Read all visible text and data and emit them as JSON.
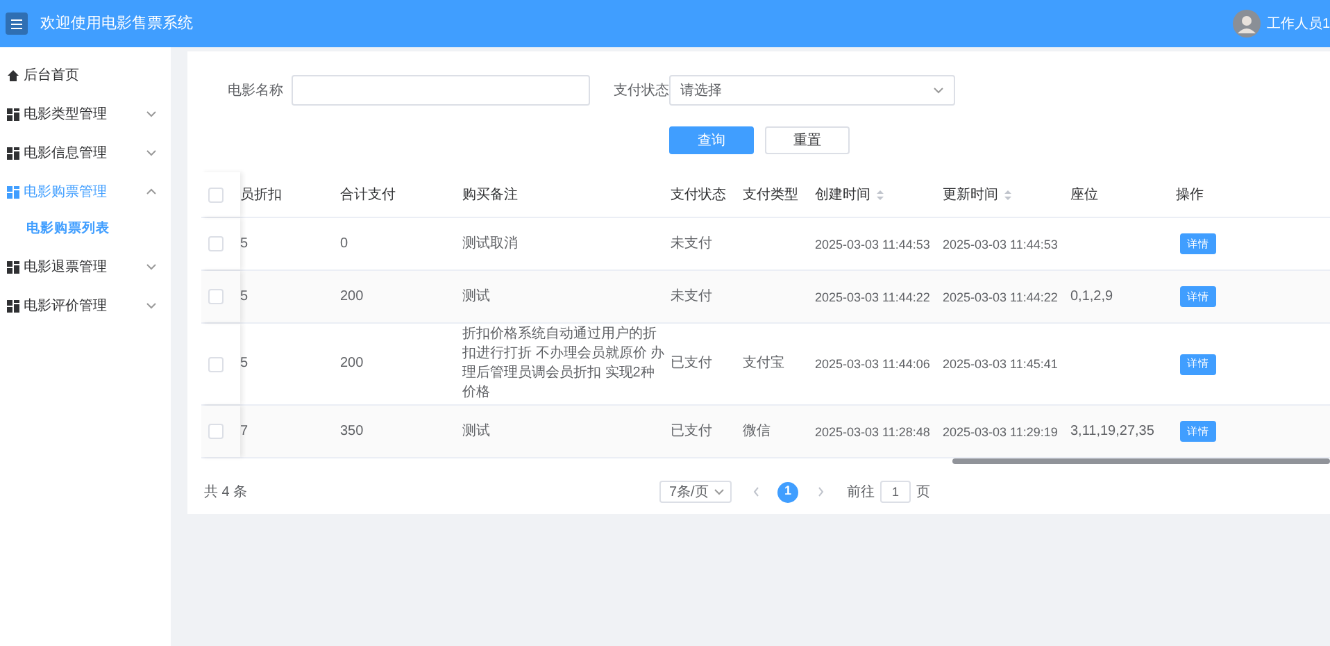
{
  "header": {
    "title": "欢迎使用电影售票系统",
    "user": "工作人员1"
  },
  "sidebar": {
    "items": [
      {
        "label": "后台首页",
        "kind": "home",
        "selected": false
      },
      {
        "label": "电影类型管理",
        "kind": "group",
        "expanded": false,
        "selected": false
      },
      {
        "label": "电影信息管理",
        "kind": "group",
        "expanded": false,
        "selected": false
      },
      {
        "label": "电影购票管理",
        "kind": "group",
        "expanded": true,
        "selected": true,
        "children": [
          {
            "label": "电影购票列表",
            "selected": true
          }
        ]
      },
      {
        "label": "电影退票管理",
        "kind": "group",
        "expanded": false,
        "selected": false
      },
      {
        "label": "电影评价管理",
        "kind": "group",
        "expanded": false,
        "selected": false
      }
    ]
  },
  "filters": {
    "movie_name": {
      "label": "电影名称"
    },
    "pay_status": {
      "label": "支付状态",
      "placeholder": "请选择"
    }
  },
  "buttons": {
    "search": "查询",
    "reset": "重置"
  },
  "table": {
    "all_checked": false,
    "columns": [
      {
        "label": "员折扣",
        "sortable": false
      },
      {
        "label": "合计支付",
        "sortable": false
      },
      {
        "label": "购买备注",
        "sortable": false
      },
      {
        "label": "支付状态",
        "sortable": false
      },
      {
        "label": "支付类型",
        "sortable": false
      },
      {
        "label": "创建时间",
        "sortable": true
      },
      {
        "label": "更新时间",
        "sortable": true
      },
      {
        "label": "座位",
        "sortable": false
      },
      {
        "label": "操作",
        "sortable": false
      }
    ],
    "rows": [
      {
        "checked": false,
        "cells": [
          "5",
          "0",
          "测试取消",
          "未支付",
          "",
          "2025-03-03 11:44:53",
          "2025-03-03 11:44:53",
          ""
        ],
        "action": "详情"
      },
      {
        "checked": false,
        "cells": [
          "5",
          "200",
          "测试",
          "未支付",
          "",
          "2025-03-03 11:44:22",
          "2025-03-03 11:44:22",
          "0,1,2,9"
        ],
        "action": "详情"
      },
      {
        "checked": false,
        "cells": [
          "5",
          "200",
          "折扣价格系统自动通过用户的折扣进行打折 不办理会员就原价 办理后管理员调会员折扣 实现2种价格",
          "已支付",
          "支付宝",
          "2025-03-03 11:44:06",
          "2025-03-03 11:45:41",
          ""
        ],
        "action": "详情"
      },
      {
        "checked": false,
        "cells": [
          "7",
          "350",
          "测试",
          "已支付",
          "微信",
          "2025-03-03 11:28:48",
          "2025-03-03 11:29:19",
          "3,11,19,27,35"
        ],
        "action": "详情"
      }
    ]
  },
  "pagination": {
    "total": "共 4 条",
    "page_size": "7条/页",
    "pages": [
      {
        "label": "1",
        "selected": true
      }
    ],
    "goto_label": "前往",
    "goto_value": "1",
    "goto_suffix": "页"
  }
}
